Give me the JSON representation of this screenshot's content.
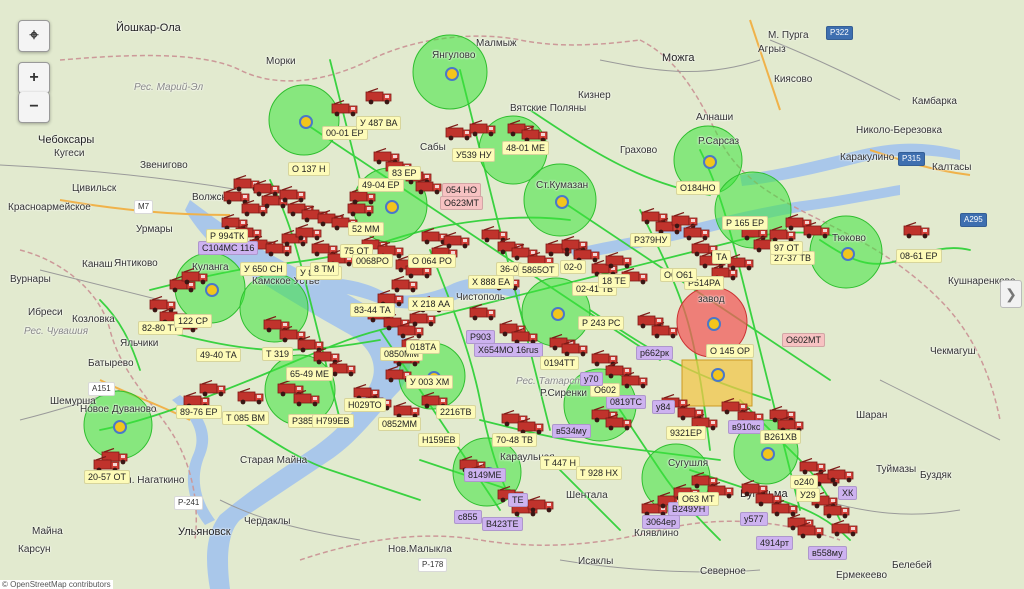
{
  "controls": {
    "locate_label": "⌖",
    "zoom_in_label": "+",
    "zoom_out_label": "−",
    "side_toggle_label": "❯"
  },
  "places": [
    {
      "id": "yoshkar",
      "text": "Йошкар-Ола"
    },
    {
      "id": "cheboksary",
      "text": "Чебоксары"
    },
    {
      "id": "kugesi",
      "text": "Кугеси"
    },
    {
      "id": "mariinsky",
      "text": "Рес. Марий-Эл"
    },
    {
      "id": "morki",
      "text": "Морки"
    },
    {
      "id": "yangulovo",
      "text": "Янгулово"
    },
    {
      "id": "malmyzh",
      "text": "Малмыж"
    },
    {
      "id": "mozhga",
      "text": "Можга"
    },
    {
      "id": "mpurga",
      "text": "М. Пурга"
    },
    {
      "id": "agryz",
      "text": "Агрыз"
    },
    {
      "id": "kiyasovo",
      "text": "Киясово"
    },
    {
      "id": "kambarka",
      "text": "Камбарка"
    },
    {
      "id": "vyatskiepolyany",
      "text": "Вятские Поляны"
    },
    {
      "id": "kizner",
      "text": "Кизнер"
    },
    {
      "id": "alnashi",
      "text": "Алнаши"
    },
    {
      "id": "grakhovo",
      "text": "Грахово"
    },
    {
      "id": "rsarsaz",
      "text": "Р.Сарсаз"
    },
    {
      "id": "karakulino",
      "text": "Каракулино"
    },
    {
      "id": "nberezovka",
      "text": "Николо-Березовка"
    },
    {
      "id": "kaltasy",
      "text": "Калтасы"
    },
    {
      "id": "zvenigovo",
      "text": "Звенигово"
    },
    {
      "id": "tsivilsk",
      "text": "Цивильск"
    },
    {
      "id": "volzhsk",
      "text": "Волжск"
    },
    {
      "id": "krasnoarmeyskoe",
      "text": "Красноармейское"
    },
    {
      "id": "urmary",
      "text": "Урмары"
    },
    {
      "id": "kanash",
      "text": "Канаш"
    },
    {
      "id": "yantikovo",
      "text": "Янтиково"
    },
    {
      "id": "vurnary",
      "text": "Вурнары"
    },
    {
      "id": "ibresi",
      "text": "Ибреси"
    },
    {
      "id": "kozlovka",
      "text": "Козловка"
    },
    {
      "id": "yalchiki",
      "text": "Яльчики"
    },
    {
      "id": "batyrevo",
      "text": "Батырево"
    },
    {
      "id": "shemursha",
      "text": "Шемурша"
    },
    {
      "id": "novoe",
      "text": "Новое Дуваново"
    },
    {
      "id": "staraya_mayna",
      "text": "Старая Майна"
    },
    {
      "id": "bnagatkino",
      "text": "Бол. Нагаткино"
    },
    {
      "id": "ulyanovsk",
      "text": "Ульяновск"
    },
    {
      "id": "cherdakly",
      "text": "Чердаклы"
    },
    {
      "id": "karsun",
      "text": "Карсун"
    },
    {
      "id": "maina",
      "text": "Майна"
    },
    {
      "id": "nmalykla",
      "text": "Нов.Малыкла"
    },
    {
      "id": "shentala",
      "text": "Шентала"
    },
    {
      "id": "isakly",
      "text": "Исаклы"
    },
    {
      "id": "klyavlino",
      "text": "Клявлино"
    },
    {
      "id": "severnoe",
      "text": "Северное"
    },
    {
      "id": "bugulma",
      "text": "Бугульма"
    },
    {
      "id": "tuymazy",
      "text": "Туймазы"
    },
    {
      "id": "buzdyak",
      "text": "Буздяк"
    },
    {
      "id": "sharan",
      "text": "Шаран"
    },
    {
      "id": "chekmagush",
      "text": "Чекмагуш"
    },
    {
      "id": "belebey",
      "text": "Белебей"
    },
    {
      "id": "ermekeevo",
      "text": "Ермекеево"
    },
    {
      "id": "kushnarenkovo",
      "text": "Кушнаренково"
    },
    {
      "id": "tyukovo",
      "text": "Тюково"
    },
    {
      "id": "kumazan",
      "text": "Ст.Кумазан"
    },
    {
      "id": "kulanga",
      "text": "Куланга"
    },
    {
      "id": "kamskoeustye",
      "text": "Камское Устье"
    },
    {
      "id": "karaulnaya",
      "text": "Караульная"
    },
    {
      "id": "sirenki",
      "text": "Р.Сиренки"
    },
    {
      "id": "susuguzh",
      "text": "Сугушля"
    },
    {
      "id": "tatmuslim",
      "text": "Рес. Татарстан"
    },
    {
      "id": "sabj",
      "text": "Сабы"
    },
    {
      "id": "chistopol",
      "text": "Чистополь"
    },
    {
      "id": "pribyvaem",
      "text": "Рес. Чувашия"
    },
    {
      "id": "rinzavod",
      "text": "завод"
    }
  ],
  "vehicles": [
    {
      "id": "v1",
      "label": "00-01 ЕР",
      "tone": "y"
    },
    {
      "id": "v2",
      "label": "У 487 ВА",
      "tone": "y"
    },
    {
      "id": "v3",
      "label": "48-01 МЕ",
      "tone": "y"
    },
    {
      "id": "v4",
      "label": "У539 НУ",
      "tone": "y"
    },
    {
      "id": "v5",
      "label": "О 137 Н",
      "tone": "y"
    },
    {
      "id": "v6",
      "label": "49-04 ЕР",
      "tone": "y"
    },
    {
      "id": "v7",
      "label": "83 ЕР",
      "tone": "y"
    },
    {
      "id": "v8",
      "label": "054 НО",
      "tone": "k"
    },
    {
      "id": "v9",
      "label": "О623МТ",
      "tone": "k"
    },
    {
      "id": "v10",
      "label": "О184НО",
      "tone": "y"
    },
    {
      "id": "v11",
      "label": "Р 165 ЕР",
      "tone": "y"
    },
    {
      "id": "v12",
      "label": "Р379НУ",
      "tone": "y"
    },
    {
      "id": "v13",
      "label": "27-37 ТВ",
      "tone": "y"
    },
    {
      "id": "v14",
      "label": "08-61 ЕР",
      "tone": "y"
    },
    {
      "id": "v15",
      "label": "С104МС 116",
      "tone": "p"
    },
    {
      "id": "v16",
      "label": "Р 994ТК",
      "tone": "y"
    },
    {
      "id": "v17",
      "label": "У 650 СН",
      "tone": "y"
    },
    {
      "id": "v18",
      "label": "У 830 АВ",
      "tone": "y"
    },
    {
      "id": "v19",
      "label": "52 ММ",
      "tone": "y"
    },
    {
      "id": "v20",
      "label": "75 ОТ",
      "tone": "y"
    },
    {
      "id": "v21",
      "label": "8 ТМ",
      "tone": "y"
    },
    {
      "id": "v22",
      "label": "0068РО",
      "tone": "y"
    },
    {
      "id": "v23",
      "label": "О 064 РО",
      "tone": "y"
    },
    {
      "id": "v24",
      "label": "Х 888 ЕА",
      "tone": "y"
    },
    {
      "id": "v25",
      "label": "36-0",
      "tone": "y"
    },
    {
      "id": "v26",
      "label": "5865ОТ",
      "tone": "y"
    },
    {
      "id": "v27",
      "label": "02-0",
      "tone": "y"
    },
    {
      "id": "v28",
      "label": "02-41 ТВ",
      "tone": "y"
    },
    {
      "id": "v29",
      "label": "18 ТЕ",
      "tone": "y"
    },
    {
      "id": "v30",
      "label": "О618",
      "tone": "y"
    },
    {
      "id": "v31",
      "label": "Р514РА",
      "tone": "y"
    },
    {
      "id": "v32",
      "label": "Х 218 АА",
      "tone": "y"
    },
    {
      "id": "v33",
      "label": "83-44 ТА",
      "tone": "y"
    },
    {
      "id": "v34",
      "label": "Р 243 РС",
      "tone": "y"
    },
    {
      "id": "v35",
      "label": "Р903",
      "tone": "p"
    },
    {
      "id": "v36",
      "label": "Х654МО 16rus",
      "tone": "p"
    },
    {
      "id": "v37",
      "label": "0850ММ",
      "tone": "y"
    },
    {
      "id": "v38",
      "label": "018ТА",
      "tone": "y"
    },
    {
      "id": "v39",
      "label": "0194ТТ",
      "tone": "y"
    },
    {
      "id": "v40",
      "label": "О 145 ОР",
      "tone": "y"
    },
    {
      "id": "v41",
      "label": "р662рк",
      "tone": "p"
    },
    {
      "id": "v42",
      "label": "О602МТ",
      "tone": "k"
    },
    {
      "id": "v43",
      "label": "82-80 ТТ",
      "tone": "y"
    },
    {
      "id": "v44",
      "label": "122 СР",
      "tone": "y"
    },
    {
      "id": "v45",
      "label": "49-40 ТА",
      "tone": "y"
    },
    {
      "id": "v46",
      "label": "Т 319",
      "tone": "y"
    },
    {
      "id": "v47",
      "label": "65-49 МЕ",
      "tone": "y"
    },
    {
      "id": "v48",
      "label": "У 003 ХМ",
      "tone": "y"
    },
    {
      "id": "v49",
      "label": "Н029ТО",
      "tone": "y"
    },
    {
      "id": "v50",
      "label": "89-76 ЕР",
      "tone": "y"
    },
    {
      "id": "v51",
      "label": "Т 085 ВМ",
      "tone": "y"
    },
    {
      "id": "v52",
      "label": "Р385",
      "tone": "y"
    },
    {
      "id": "v53",
      "label": "Н799ЕВ",
      "tone": "y"
    },
    {
      "id": "v54",
      "label": "0852ММ",
      "tone": "y"
    },
    {
      "id": "v55",
      "label": "2216ТВ",
      "tone": "y"
    },
    {
      "id": "v56",
      "label": "Н159ЕВ",
      "tone": "y"
    },
    {
      "id": "v57",
      "label": "70-48 ТВ",
      "tone": "y"
    },
    {
      "id": "v58",
      "label": "0819ТС",
      "tone": "p"
    },
    {
      "id": "v59",
      "label": "О602",
      "tone": "y"
    },
    {
      "id": "v60",
      "label": "у84",
      "tone": "p"
    },
    {
      "id": "v61",
      "label": "у70",
      "tone": "p"
    },
    {
      "id": "v62",
      "label": "9321ЕР",
      "tone": "y"
    },
    {
      "id": "v63",
      "label": "в910кс",
      "tone": "p"
    },
    {
      "id": "v64",
      "label": "В261ХВ",
      "tone": "y"
    },
    {
      "id": "v65",
      "label": "в534му",
      "tone": "p"
    },
    {
      "id": "v66",
      "label": "Т 447 Н",
      "tone": "y"
    },
    {
      "id": "v67",
      "label": "Т 928 НХ",
      "tone": "y"
    },
    {
      "id": "v68",
      "label": "8149МЕ",
      "tone": "p"
    },
    {
      "id": "v69",
      "label": "ТЕ",
      "tone": "p"
    },
    {
      "id": "v70",
      "label": "с855",
      "tone": "p"
    },
    {
      "id": "v71",
      "label": "В423ТЕ",
      "tone": "p"
    },
    {
      "id": "v72",
      "label": "20-57 ОТ",
      "tone": "y"
    },
    {
      "id": "v73",
      "label": "В249УН",
      "tone": "p"
    },
    {
      "id": "v74",
      "label": "3064ер",
      "tone": "p"
    },
    {
      "id": "v75",
      "label": "О63 МТ",
      "tone": "y"
    },
    {
      "id": "v76",
      "label": "о240",
      "tone": "y"
    },
    {
      "id": "v77",
      "label": "У29",
      "tone": "y"
    },
    {
      "id": "v78",
      "label": "у577",
      "tone": "p"
    },
    {
      "id": "v79",
      "label": "4914рт",
      "tone": "p"
    },
    {
      "id": "v80",
      "label": "в558му",
      "tone": "p"
    },
    {
      "id": "v81",
      "label": "ХК",
      "tone": "p"
    },
    {
      "id": "v82",
      "label": "О61",
      "tone": "y"
    },
    {
      "id": "v83",
      "label": "97 ОТ",
      "tone": "y"
    },
    {
      "id": "v84",
      "label": "ТА",
      "tone": "y"
    }
  ],
  "road_labels": [
    {
      "id": "m7",
      "text": "М7"
    },
    {
      "id": "a151",
      "text": "А151"
    },
    {
      "id": "p241",
      "text": "Р-241"
    },
    {
      "id": "p178",
      "text": "Р-178"
    },
    {
      "id": "p315",
      "text": "Р315"
    },
    {
      "id": "p322",
      "text": "Р322"
    },
    {
      "id": "a295",
      "text": "А295"
    }
  ],
  "footer": {
    "text": "© OpenStreetMap contributors"
  }
}
